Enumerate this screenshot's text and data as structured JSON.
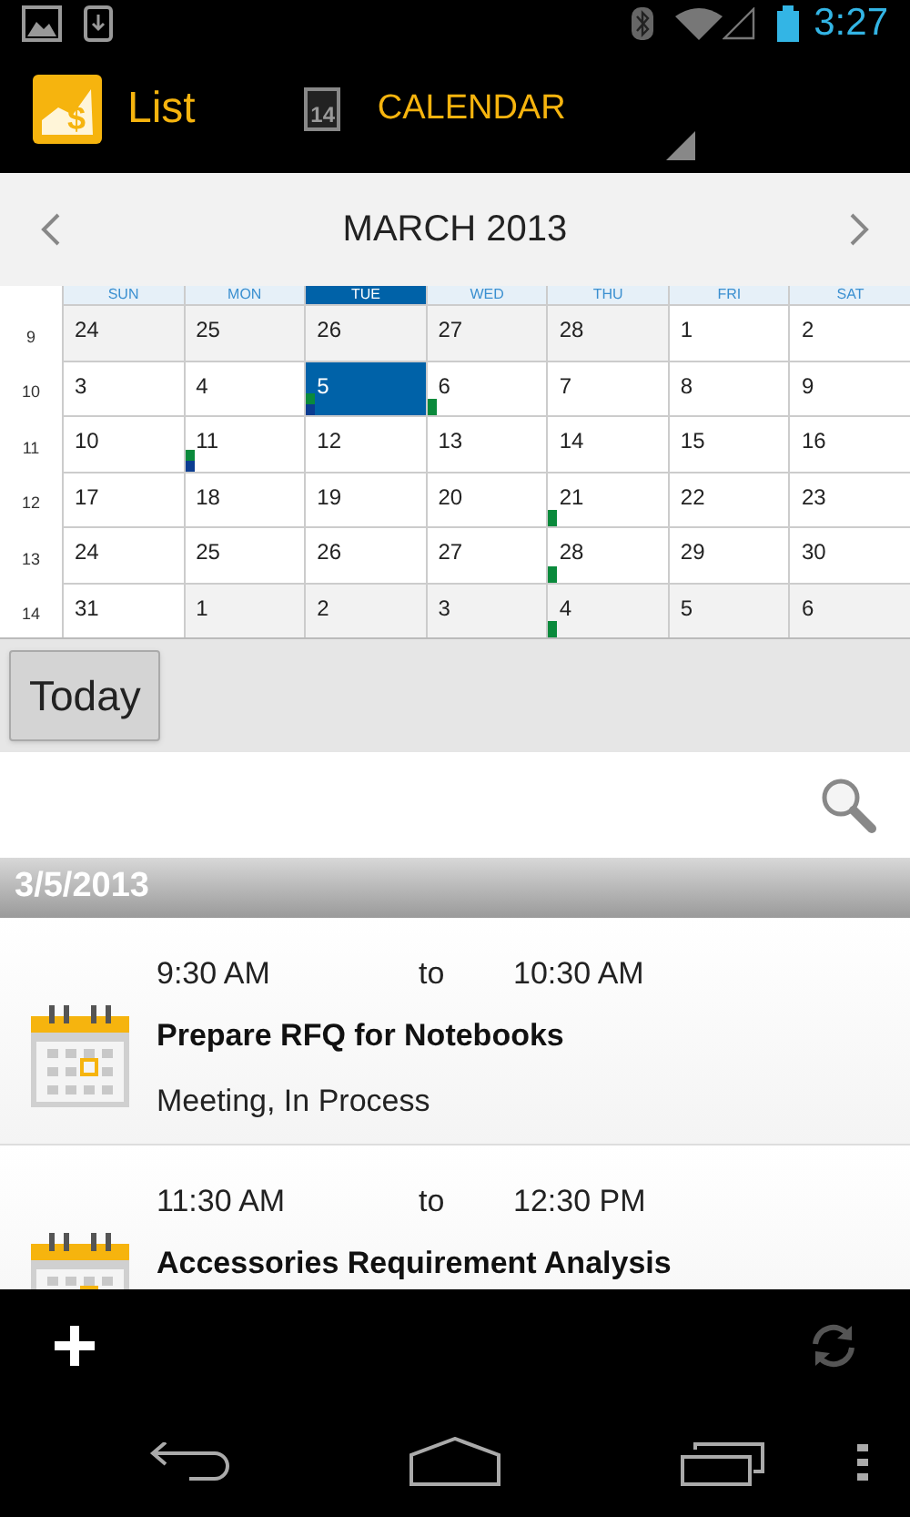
{
  "status_bar": {
    "time": "3:27"
  },
  "action_bar": {
    "logo_glyph": "$",
    "title": "List",
    "calendar_icon_day": "14",
    "view_label": "CALENDAR"
  },
  "calendar": {
    "month_title": "MARCH 2013",
    "weekdays": [
      {
        "label": "SUN",
        "selected": false
      },
      {
        "label": "MON",
        "selected": false
      },
      {
        "label": "TUE",
        "selected": true
      },
      {
        "label": "WED",
        "selected": false
      },
      {
        "label": "THU",
        "selected": false
      },
      {
        "label": "FRI",
        "selected": false
      },
      {
        "label": "SAT",
        "selected": false
      }
    ],
    "weeks": [
      {
        "number": "9",
        "days": [
          {
            "label": "24",
            "in_month": false,
            "selected": false
          },
          {
            "label": "25",
            "in_month": false,
            "selected": false
          },
          {
            "label": "26",
            "in_month": false,
            "selected": false
          },
          {
            "label": "27",
            "in_month": false,
            "selected": false
          },
          {
            "label": "28",
            "in_month": false,
            "selected": false
          },
          {
            "label": "1",
            "in_month": true,
            "selected": false
          },
          {
            "label": "2",
            "in_month": true,
            "selected": false
          }
        ]
      },
      {
        "number": "10",
        "days": [
          {
            "label": "3",
            "in_month": true,
            "selected": false
          },
          {
            "label": "4",
            "in_month": true,
            "selected": false
          },
          {
            "label": "5",
            "in_month": true,
            "selected": true,
            "markers": [
              {
                "color": "#0a8a3c"
              },
              {
                "color": "#0b3d91"
              }
            ]
          },
          {
            "label": "6",
            "in_month": true,
            "selected": false,
            "markers": [
              {
                "color": "#0a8a3c"
              }
            ]
          },
          {
            "label": "7",
            "in_month": true,
            "selected": false
          },
          {
            "label": "8",
            "in_month": true,
            "selected": false
          },
          {
            "label": "9",
            "in_month": true,
            "selected": false
          }
        ]
      },
      {
        "number": "11",
        "days": [
          {
            "label": "10",
            "in_month": true,
            "selected": false
          },
          {
            "label": "11",
            "in_month": true,
            "selected": false,
            "markers": [
              {
                "color": "#0a8a3c"
              },
              {
                "color": "#0b3d91"
              }
            ]
          },
          {
            "label": "12",
            "in_month": true,
            "selected": false
          },
          {
            "label": "13",
            "in_month": true,
            "selected": false
          },
          {
            "label": "14",
            "in_month": true,
            "selected": false
          },
          {
            "label": "15",
            "in_month": true,
            "selected": false
          },
          {
            "label": "16",
            "in_month": true,
            "selected": false
          }
        ]
      },
      {
        "number": "12",
        "days": [
          {
            "label": "17",
            "in_month": true,
            "selected": false
          },
          {
            "label": "18",
            "in_month": true,
            "selected": false
          },
          {
            "label": "19",
            "in_month": true,
            "selected": false
          },
          {
            "label": "20",
            "in_month": true,
            "selected": false
          },
          {
            "label": "21",
            "in_month": true,
            "selected": false,
            "markers": [
              {
                "color": "#0a8a3c"
              }
            ]
          },
          {
            "label": "22",
            "in_month": true,
            "selected": false
          },
          {
            "label": "23",
            "in_month": true,
            "selected": false
          }
        ]
      },
      {
        "number": "13",
        "days": [
          {
            "label": "24",
            "in_month": true,
            "selected": false
          },
          {
            "label": "25",
            "in_month": true,
            "selected": false
          },
          {
            "label": "26",
            "in_month": true,
            "selected": false
          },
          {
            "label": "27",
            "in_month": true,
            "selected": false
          },
          {
            "label": "28",
            "in_month": true,
            "selected": false,
            "markers": [
              {
                "color": "#0a8a3c"
              }
            ]
          },
          {
            "label": "29",
            "in_month": true,
            "selected": false
          },
          {
            "label": "30",
            "in_month": true,
            "selected": false
          }
        ]
      },
      {
        "number": "14",
        "days": [
          {
            "label": "31",
            "in_month": true,
            "selected": false
          },
          {
            "label": "1",
            "in_month": false,
            "selected": false
          },
          {
            "label": "2",
            "in_month": false,
            "selected": false
          },
          {
            "label": "3",
            "in_month": false,
            "selected": false
          },
          {
            "label": "4",
            "in_month": false,
            "selected": false,
            "markers": [
              {
                "color": "#0a8a3c"
              }
            ]
          },
          {
            "label": "5",
            "in_month": false,
            "selected": false
          },
          {
            "label": "6",
            "in_month": false,
            "selected": false
          }
        ]
      }
    ]
  },
  "today_button": "Today",
  "date_header": "3/5/2013",
  "events": [
    {
      "start": "9:30 AM",
      "to": "to",
      "end": "10:30 AM",
      "title": "Prepare RFQ for Notebooks",
      "subtitle": "Meeting, In Process"
    },
    {
      "start": "11:30 AM",
      "to": "to",
      "end": "12:30 PM",
      "title": "Accessories Requirement Analysis"
    }
  ]
}
